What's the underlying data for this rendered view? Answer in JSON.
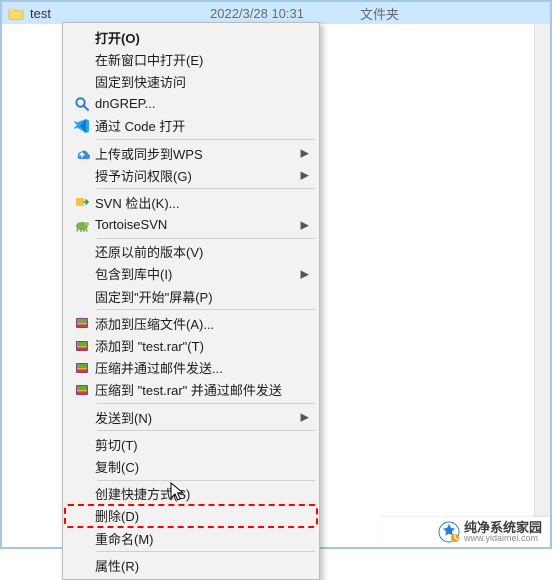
{
  "folder_row": {
    "name": "test",
    "date": "2022/3/28 10:31",
    "type": "文件夹"
  },
  "menu": {
    "open": "打开(O)",
    "open_new_window": "在新窗口中打开(E)",
    "pin_quick_access": "固定到快速访问",
    "dngrep": "dnGREP...",
    "open_with_code": "通过 Code 打开",
    "upload_wps": "上传或同步到WPS",
    "grant_access": "授予访问权限(G)",
    "svn_checkout": "SVN 检出(K)...",
    "tortoise_svn": "TortoiseSVN",
    "restore_versions": "还原以前的版本(V)",
    "include_in_library": "包含到库中(I)",
    "pin_start": "固定到\"开始\"屏幕(P)",
    "add_to_archive": "添加到压缩文件(A)...",
    "add_to_test_rar": "添加到 \"test.rar\"(T)",
    "compress_email": "压缩并通过邮件发送...",
    "compress_test_rar_email": "压缩到 \"test.rar\" 并通过邮件发送",
    "send_to": "发送到(N)",
    "cut": "剪切(T)",
    "copy": "复制(C)",
    "create_shortcut": "创建快捷方式(S)",
    "delete": "删除(D)",
    "rename": "重命名(M)",
    "properties": "属性(R)"
  },
  "footer": {
    "brand": "纯净系统家园",
    "domain": "www.yidaimei.com"
  },
  "colors": {
    "selection_bg": "#cce8ff",
    "menu_bg": "#f2f2f2",
    "border": "#bcbcbc",
    "highlight": "#ff0000"
  }
}
